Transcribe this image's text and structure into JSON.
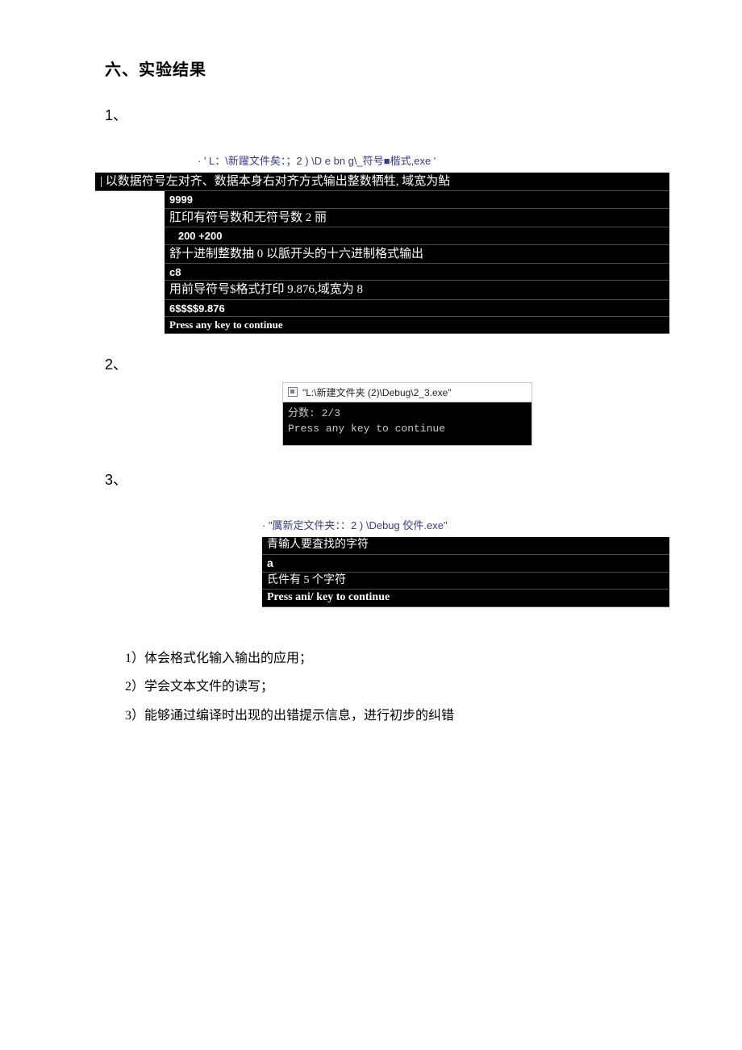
{
  "heading": "六、实验结果",
  "section_labels": {
    "s1": "1、",
    "s2": "2、",
    "s3": "3、"
  },
  "block1": {
    "path": "· ' L：\\新躍文件矣：；2 ) \\D e bn g\\_符号■楷式,exe '",
    "lines": [
      {
        "cls": "cn",
        "text": "| 以数据符号左对齐、数据本身右对齐方式输出整数牺牲, 域宽为鲇"
      },
      {
        "cls": "small bold indent1",
        "text": "9999"
      },
      {
        "cls": "cn indent1",
        "text": "肛印有符号数和无符号数 2 丽"
      },
      {
        "cls": "small bold indent1",
        "text": "   200 +200"
      },
      {
        "cls": "cn indent1",
        "text": "舒十进制整数抽 0 以脈开头的十六进制格式输出"
      },
      {
        "cls": "small bold indent1",
        "text": "c8"
      },
      {
        "cls": "cn indent1",
        "text": "用前导符号$格式打印 9.876,域宽为 8"
      },
      {
        "cls": "small bold indent1",
        "text": "6$$$$9.876"
      },
      {
        "cls": "eng indent1",
        "text": "Press any key to continue"
      }
    ]
  },
  "block2": {
    "title": "\"L:\\新建文件夹 (2)\\Debug\\2_3.exe\"",
    "body": "分数: 2/3\nPress any key to continue"
  },
  "block3": {
    "path": "· \"厲新定文件夹：：2 ) \\Debug 佼件.exe\"",
    "lines": [
      {
        "cls": "cn",
        "text": "青输人要査找的字符"
      },
      {
        "cls": "small bold",
        "text": "a"
      },
      {
        "cls": "cn",
        "text": "氏件有 5 个字符"
      },
      {
        "cls": "eng",
        "text": "Press ani/ key to continue"
      }
    ]
  },
  "points": [
    "1）体会格式化输入输出的应用；",
    "2）学会文本文件的读写；",
    "3）能够通过编译时出现的出错提示信息，进行初步的纠错"
  ]
}
